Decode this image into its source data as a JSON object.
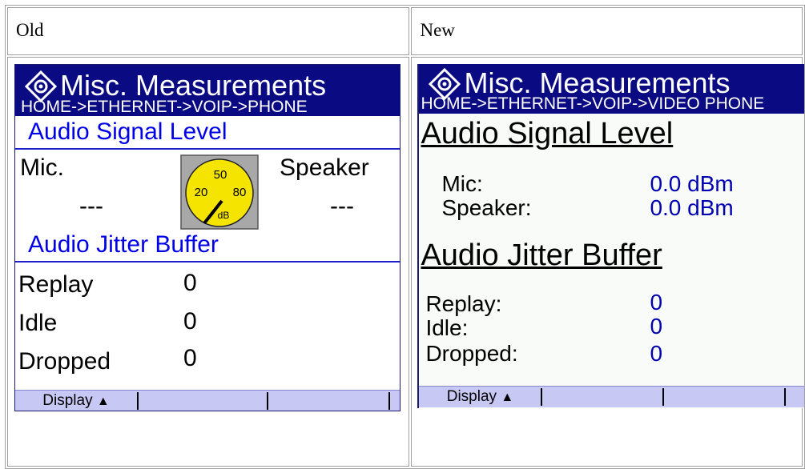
{
  "columns": {
    "old": "Old",
    "new": "New"
  },
  "old_screen": {
    "title": "Misc. Measurements",
    "breadcrumb": "HOME->ETHERNET->VOIP->PHONE",
    "signal_section": "Audio Signal Level",
    "mic_label": "Mic.",
    "speaker_label": "Speaker",
    "mic_value": "---",
    "speaker_value": "---",
    "gauge": {
      "tick_50": "50",
      "tick_20": "20",
      "tick_80": "80",
      "unit": "dB"
    },
    "jitter_section": "Audio Jitter Buffer",
    "rows": [
      {
        "label": "Replay",
        "value": "0"
      },
      {
        "label": "Idle",
        "value": "0"
      },
      {
        "label": "Dropped",
        "value": "0"
      }
    ],
    "softkey": "Display"
  },
  "new_screen": {
    "title": "Misc. Measurements",
    "breadcrumb": "HOME->ETHERNET->VOIP->VIDEO PHONE",
    "signal_section": "Audio Signal Level",
    "mic_label": "Mic:",
    "mic_value": "0.0 dBm",
    "speaker_label": "Speaker:",
    "speaker_value": "0.0 dBm",
    "jitter_section": "Audio Jitter Buffer",
    "rows": [
      {
        "label": "Replay:",
        "value": "0"
      },
      {
        "label": "Idle:",
        "value": "0"
      },
      {
        "label": "Dropped:",
        "value": "0"
      }
    ],
    "softkey": "Display"
  },
  "icons": {
    "app_icon": "gear-in-diamond-icon",
    "softkey_arrow": "triangle-up-icon"
  },
  "colors": {
    "titlebar": "#0a0a82",
    "section_old": "#0000e6",
    "value_new": "#0000b0",
    "softkey_bar": "#c8c8f4",
    "gauge_face": "#f5e400"
  }
}
